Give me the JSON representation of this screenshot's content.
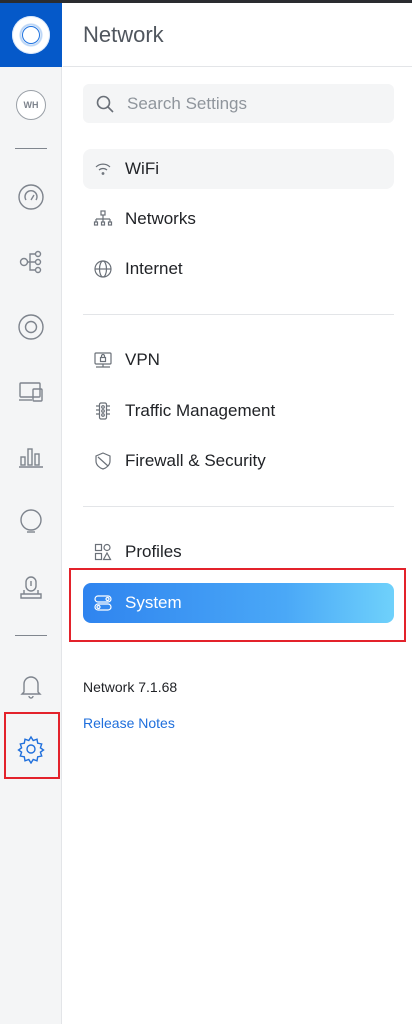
{
  "app": {
    "title": "Network",
    "accent": "#0559c9"
  },
  "rail": {
    "avatar_initials": "WH",
    "icons": [
      "dashboard-icon",
      "topology-icon",
      "devices-icon",
      "client-devices-icon",
      "statistics-icon",
      "insights-icon",
      "alarm-manager-icon",
      "notifications-icon",
      "settings-icon"
    ]
  },
  "search": {
    "placeholder": "Search Settings",
    "value": ""
  },
  "menu": {
    "group1": [
      {
        "label": "WiFi",
        "icon": "wifi-icon"
      },
      {
        "label": "Networks",
        "icon": "networks-icon"
      },
      {
        "label": "Internet",
        "icon": "globe-icon"
      }
    ],
    "group2": [
      {
        "label": "VPN",
        "icon": "vpn-icon"
      },
      {
        "label": "Traffic Management",
        "icon": "traffic-icon"
      },
      {
        "label": "Firewall & Security",
        "icon": "shield-icon"
      }
    ],
    "group3": [
      {
        "label": "Profiles",
        "icon": "profiles-icon"
      },
      {
        "label": "System",
        "icon": "toggle-icon"
      }
    ]
  },
  "footer": {
    "version": "Network 7.1.68",
    "release_notes": "Release Notes"
  }
}
